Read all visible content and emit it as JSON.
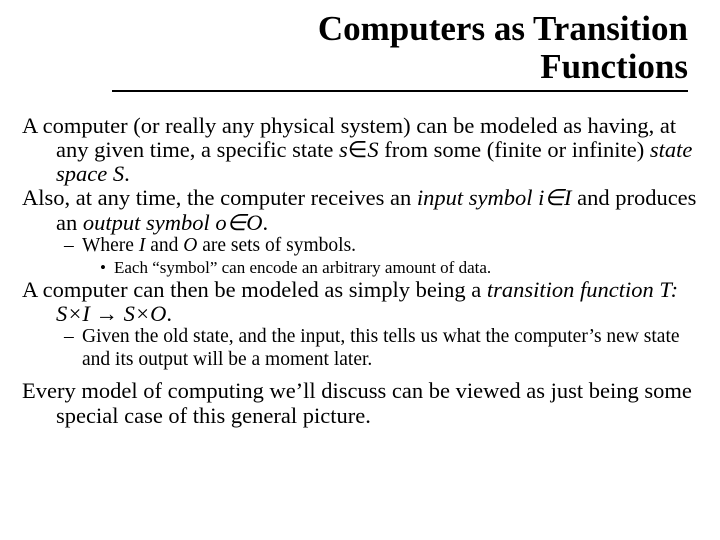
{
  "title": {
    "line1": "Computers as Transition",
    "line2": "Functions"
  },
  "para1": {
    "t1": "A computer (or really any physical system) can be modeled as having, at any given time, a specific state ",
    "s": "s",
    "in": "∈",
    "S1": "S",
    "t2": " from some (finite or infinite) ",
    "ss": "state space",
    "S2": " S",
    "dot": "."
  },
  "para2": {
    "t1": "Also, at any time, the computer receives an ",
    "isym": "input symbol",
    "iin": " i∈I",
    "t2": " and produces an ",
    "osym": "output symbol",
    "oin": " o∈O",
    "dot": "."
  },
  "sub1": {
    "t1": "Where ",
    "I": "I",
    "t2": " and ",
    "O": "O",
    "t3": " are sets of symbols."
  },
  "sub1a": "Each “symbol” can encode an arbitrary amount of data.",
  "para3": {
    "t1": "A computer can then be modeled as simply being a ",
    "tf": "transition function",
    "fn": " T: S×I → S×O",
    "dot": "."
  },
  "sub2": "Given the old state, and the input, this tells us what the computer’s new state and its output will be a moment later.",
  "para4": "Every model of computing we’ll discuss can be viewed as just being some special case of this general picture.",
  "dash": "– ",
  "bullet": "• "
}
